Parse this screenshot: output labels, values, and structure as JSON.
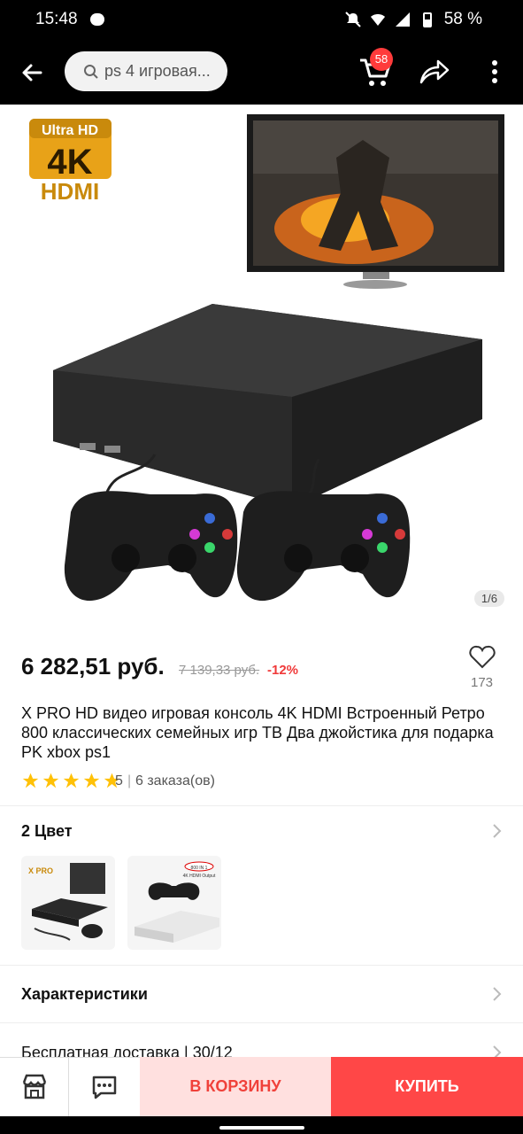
{
  "status": {
    "time": "15:48",
    "battery": "58 %"
  },
  "search": {
    "query": "ps 4 игровая..."
  },
  "cart": {
    "count": "58"
  },
  "hero": {
    "counter": "1/6",
    "ultra": "Ultra HD",
    "fourk": "4K",
    "hdmi": "HDMI"
  },
  "product": {
    "price": "6 282,51 руб.",
    "old_price": "7 139,33 руб.",
    "discount": "-12%",
    "favorites": "173",
    "title": "X PRO HD видео игровая консоль 4K HDMI Встроенный Ретро 800 классических семейных игр ТВ Два джойстика для подарка PK xbox ps1",
    "rating": "5",
    "rating_stars": 5,
    "orders": "6 заказа(ов)"
  },
  "variants": {
    "title": "2 Цвет",
    "items": [
      {
        "label": "X PRO"
      },
      {
        "label": "800 IN 1",
        "sub": "4K HDMI Output"
      }
    ]
  },
  "sections": {
    "specs": "Характеристики",
    "delivery": "Бесплатная доставка | 30/12"
  },
  "bottom": {
    "add_to_cart": "В КОРЗИНУ",
    "buy": "КУПИТЬ"
  },
  "colors": {
    "accent": "#ff4747",
    "accent_light": "#ffe0df",
    "star": "#ffc107"
  }
}
